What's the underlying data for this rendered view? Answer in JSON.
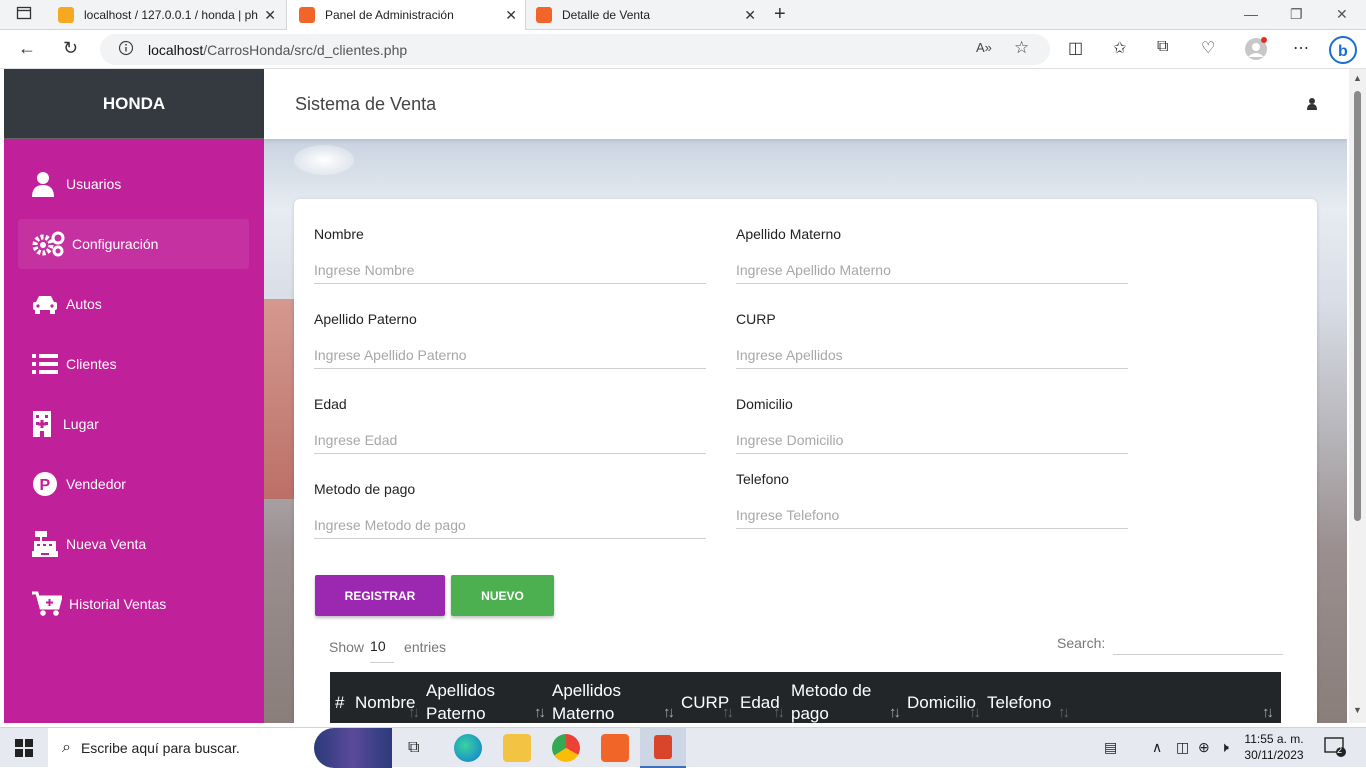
{
  "browser": {
    "tabs": [
      {
        "title": "localhost / 127.0.0.1 / honda | ph"
      },
      {
        "title": "Panel de Administración"
      },
      {
        "title": "Detalle de Venta"
      }
    ],
    "url_host": "localhost",
    "url_path": "/CarrosHonda/src/d_clientes.php"
  },
  "sidebar": {
    "brand": "HONDA",
    "items": [
      {
        "label": "Usuarios",
        "icon": "user-icon"
      },
      {
        "label": "Configuración",
        "icon": "gears-icon"
      },
      {
        "label": "Autos",
        "icon": "car-icon"
      },
      {
        "label": "Clientes",
        "icon": "list-icon"
      },
      {
        "label": "Lugar",
        "icon": "building-icon"
      },
      {
        "label": "Vendedor",
        "icon": "parking-icon"
      },
      {
        "label": "Nueva Venta",
        "icon": "cash-register-icon"
      },
      {
        "label": "Historial Ventas",
        "icon": "cart-plus-icon"
      }
    ],
    "active_index": 1
  },
  "header": {
    "title": "Sistema de Venta"
  },
  "form": {
    "nombre": {
      "label": "Nombre",
      "placeholder": "Ingrese Nombre"
    },
    "apellido_materno": {
      "label": "Apellido Materno",
      "placeholder": "Ingrese Apellido Materno"
    },
    "apellido_paterno": {
      "label": "Apellido Paterno",
      "placeholder": "Ingrese Apellido Paterno"
    },
    "curp": {
      "label": "CURP",
      "placeholder": "Ingrese Apellidos"
    },
    "edad": {
      "label": "Edad",
      "placeholder": "Ingrese Edad"
    },
    "domicilio": {
      "label": "Domicilio",
      "placeholder": "Ingrese Domicilio"
    },
    "metodo_pago": {
      "label": "Metodo de pago",
      "placeholder": "Ingrese Metodo de pago"
    },
    "telefono": {
      "label": "Telefono",
      "placeholder": "Ingrese Telefono"
    },
    "register_label": "REGISTRAR",
    "new_label": "NUEVO"
  },
  "table": {
    "show_label": "Show",
    "entries_value": "10",
    "entries_label": "entries",
    "search_label": "Search:",
    "columns": [
      "#",
      "Nombre",
      "Apellidos Paterno",
      "Apellidos Materno",
      "CURP",
      "Edad",
      "Metodo de pago",
      "Domicilio",
      "Telefono",
      ""
    ]
  },
  "taskbar": {
    "search_placeholder": "Escribe aquí para buscar.",
    "time": "11:55 a. m.",
    "date": "30/11/2023",
    "notifications": "2"
  },
  "colors": {
    "sidebar": "#c0209a",
    "brand_bg": "#343a40",
    "register_btn": "#9c27b0",
    "new_btn": "#4caf50",
    "table_header": "#222629"
  }
}
